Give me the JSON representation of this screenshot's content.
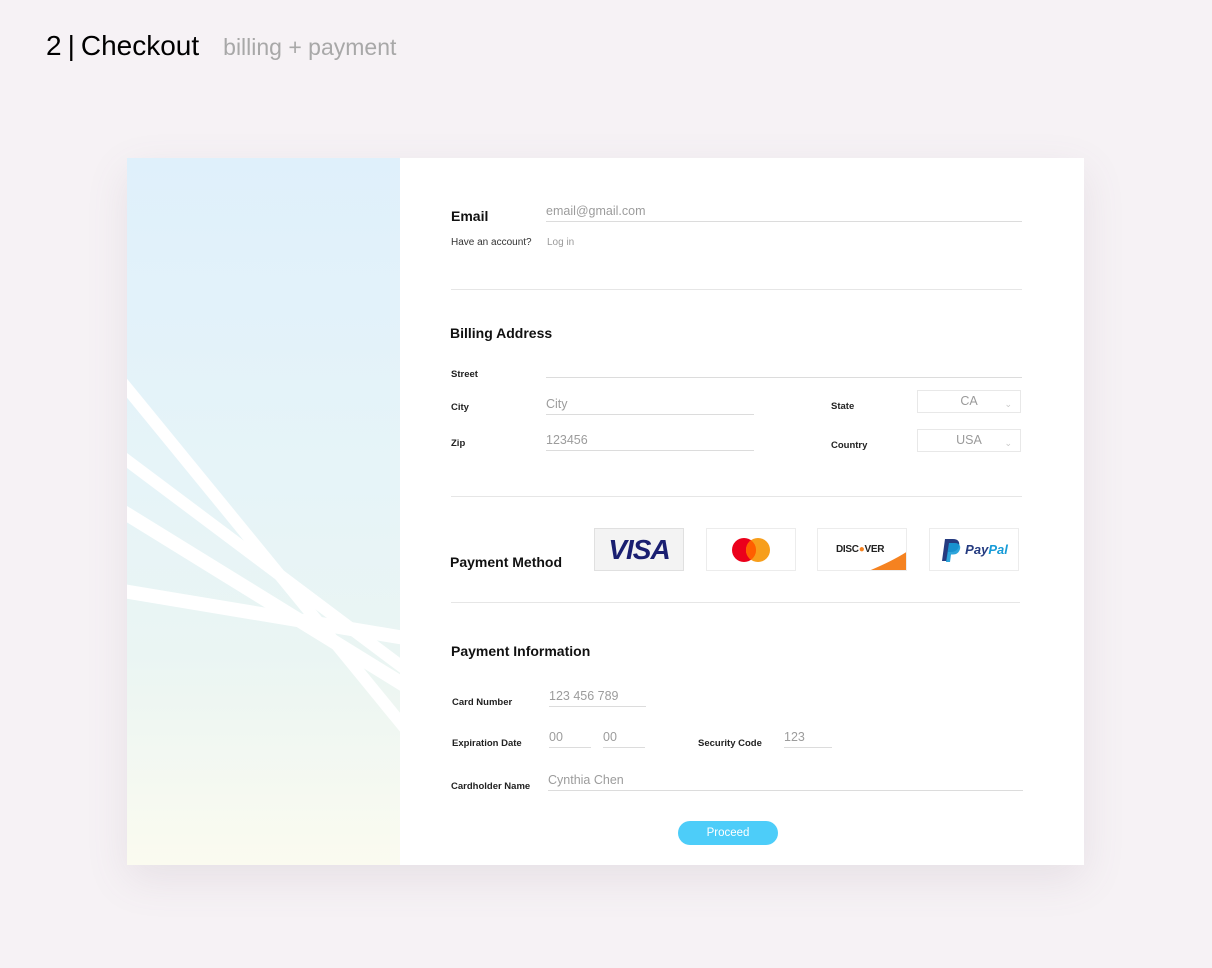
{
  "header": {
    "step_number": "2",
    "separator": "|",
    "title": "Checkout",
    "subtitle": "billing + payment"
  },
  "email_section": {
    "label": "Email",
    "placeholder": "email@gmail.com",
    "have_account_text": "Have an account?",
    "login_link": "Log in"
  },
  "billing": {
    "title": "Billing Address",
    "street_label": "Street",
    "street_value": "",
    "city_label": "City",
    "city_placeholder": "City",
    "zip_label": "Zip",
    "zip_placeholder": "123456",
    "state_label": "State",
    "state_value": "CA",
    "country_label": "Country",
    "country_value": "USA"
  },
  "payment_method": {
    "title": "Payment Method",
    "options": [
      {
        "name": "VISA",
        "selected": true
      },
      {
        "name": "mastercard",
        "selected": false
      },
      {
        "name": "DISCOVER",
        "selected": false
      },
      {
        "name": "PayPal",
        "selected": false
      }
    ],
    "visa_text": "VISA",
    "discover_text_a": "DISC",
    "discover_text_b": "VER",
    "paypal_pay": "Pay",
    "paypal_pal": "Pal"
  },
  "payment_info": {
    "title": "Payment Information",
    "card_number_label": "Card Number",
    "card_number_placeholder": "123 456 789",
    "expiration_label": "Expiration Date",
    "exp_month_placeholder": "00",
    "exp_year_placeholder": "00",
    "security_label": "Security Code",
    "security_placeholder": "123",
    "cardholder_label": "Cardholder Name",
    "cardholder_placeholder": "Cynthia Chen"
  },
  "actions": {
    "proceed_label": "Proceed"
  },
  "colors": {
    "accent": "#4dcdf9",
    "visa_blue": "#1a1f71",
    "mastercard_red": "#eb001b",
    "mastercard_orange": "#f79e1b",
    "discover_orange": "#f58220",
    "paypal_dark": "#253b80",
    "paypal_light": "#179bd7"
  }
}
